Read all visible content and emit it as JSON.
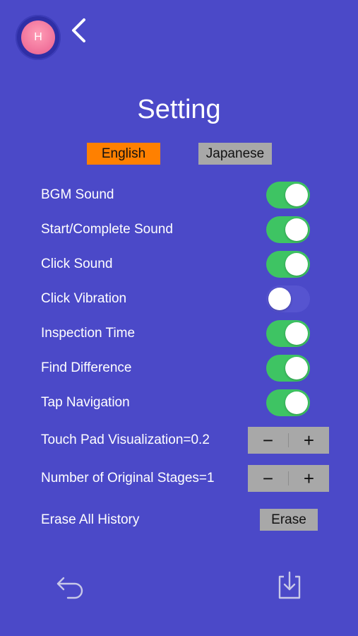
{
  "avatar": {
    "initial": "H"
  },
  "page": {
    "title": "Setting"
  },
  "language": {
    "english": "English",
    "japanese": "Japanese",
    "selected": "English"
  },
  "settings": [
    {
      "label": "BGM Sound",
      "on": true
    },
    {
      "label": "Start/Complete Sound",
      "on": true
    },
    {
      "label": "Click Sound",
      "on": true
    },
    {
      "label": "Click Vibration",
      "on": false
    },
    {
      "label": "Inspection Time",
      "on": true
    },
    {
      "label": "Find Difference",
      "on": true
    },
    {
      "label": "Tap Navigation",
      "on": true
    }
  ],
  "steppers": [
    {
      "label": "Touch Pad Visualization=0.2",
      "minus": "−",
      "plus": "+"
    },
    {
      "label": "Number of Original Stages=1",
      "minus": "−",
      "plus": "+"
    }
  ],
  "erase": {
    "label": "Erase All History",
    "button": "Erase"
  },
  "icons": {
    "back": "chevron-left-icon",
    "undo": "undo-arrow-icon",
    "save": "download-tray-icon"
  },
  "colors": {
    "background": "#4b49c8",
    "selected_language": "#ff8000",
    "unselected_button": "#a8a8a8",
    "toggle_on": "#3ec463",
    "toggle_off": "#5654d0"
  }
}
